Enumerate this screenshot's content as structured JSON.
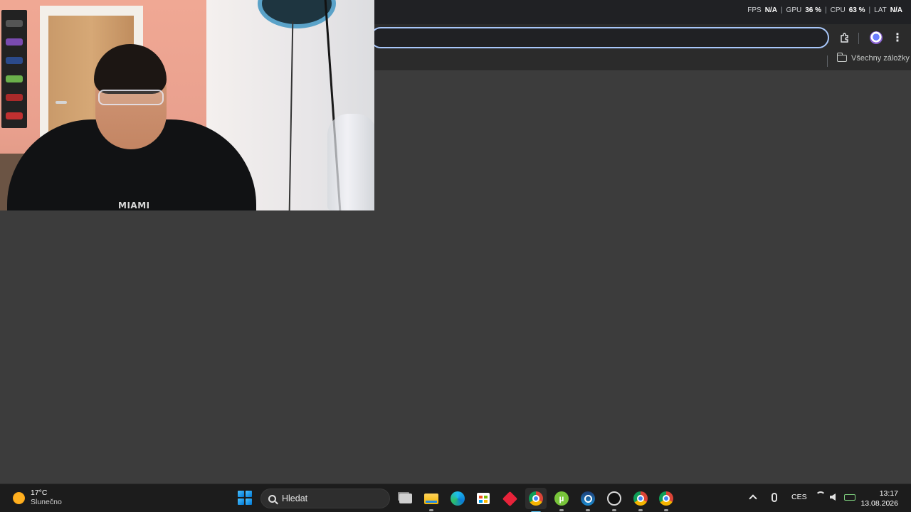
{
  "window": {
    "perf_overlay": {
      "fps_label": "FPS",
      "fps_value": "N/A",
      "gpu_label": "GPU",
      "gpu_value": "36 %",
      "cpu_label": "CPU",
      "cpu_value": "63 %",
      "lat_label": "LAT",
      "lat_value": "N/A",
      "separator": "|"
    }
  },
  "browser": {
    "omnibox_value": "",
    "bookmarks_bar": {
      "all_bookmarks_label": "Všechny záložky"
    }
  },
  "webcam": {
    "shirt_text": "MIAMI"
  },
  "taskbar": {
    "weather": {
      "temperature": "17°C",
      "condition": "Slunečno"
    },
    "search_placeholder": "Hledat",
    "apps": [
      {
        "name": "task-view",
        "icon": "task-view-icon"
      },
      {
        "name": "file-explorer",
        "icon": "folder-icon"
      },
      {
        "name": "edge",
        "icon": "edge-icon"
      },
      {
        "name": "microsoft-store",
        "icon": "store-icon"
      },
      {
        "name": "app-red",
        "icon": "red-diamond-icon"
      },
      {
        "name": "chrome",
        "icon": "chrome-icon",
        "active": true
      },
      {
        "name": "utorrent",
        "icon": "utorrent-icon"
      },
      {
        "name": "steam",
        "icon": "steam-icon"
      },
      {
        "name": "obs",
        "icon": "obs-icon"
      },
      {
        "name": "chrome-profile-1",
        "icon": "chrome-icon"
      },
      {
        "name": "chrome-profile-2",
        "icon": "chrome-icon"
      }
    ],
    "tray": {
      "language": "CES",
      "time": "13:17",
      "date": "13.08.2026"
    }
  },
  "colors": {
    "page_background": "#3c3c3c",
    "titlebar": "#202124",
    "toolbar": "#2b2b2b",
    "omnibox_focus": "#a8c7fa",
    "taskbar": "#1c1c1c",
    "active_indicator": "#60cdff"
  }
}
